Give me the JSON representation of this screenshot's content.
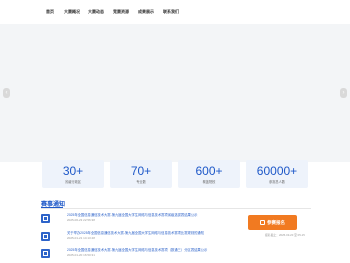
{
  "nav": {
    "items": [
      "首页",
      "大赛概况",
      "大赛动态",
      "竞赛资源",
      "成果展示",
      "联系我们"
    ]
  },
  "banner": {
    "prev_glyph": "‹",
    "next_glyph": "›"
  },
  "stats": [
    {
      "value": "30+",
      "label": "省级行政区"
    },
    {
      "value": "70+",
      "label": "专业数"
    },
    {
      "value": "600+",
      "label": "覆盖院校"
    },
    {
      "value": "60000+",
      "label": "参赛总人数"
    }
  ],
  "notices": {
    "title": "赛事通知",
    "items": [
      {
        "title": "2025年全国信息通信技术大赛-第九届全国大学生网络与信息技术赛项省级选拔赛结果公示",
        "date": "2025-06-23 22:56:38"
      },
      {
        "title": "关于举办2025年全国信息通信技术大赛-第九届全国大学生网络与信息技术赛项比赛规则的通知",
        "date": "2025-01-21 14:13:48"
      },
      {
        "title": "2025年全国信息通信技术大赛-第九届全国大学生网络与信息技术赛项（数通三）分区赛结果公示",
        "date": "2025-01-20 16:50:31"
      }
    ]
  },
  "signup": {
    "label": "参赛报名",
    "date_text": "报名截止：2025-03-20 至 05-15"
  },
  "colors": {
    "accent": "#1e58c8",
    "button": "#f17a21",
    "stat_bg": "#eef3fb"
  }
}
